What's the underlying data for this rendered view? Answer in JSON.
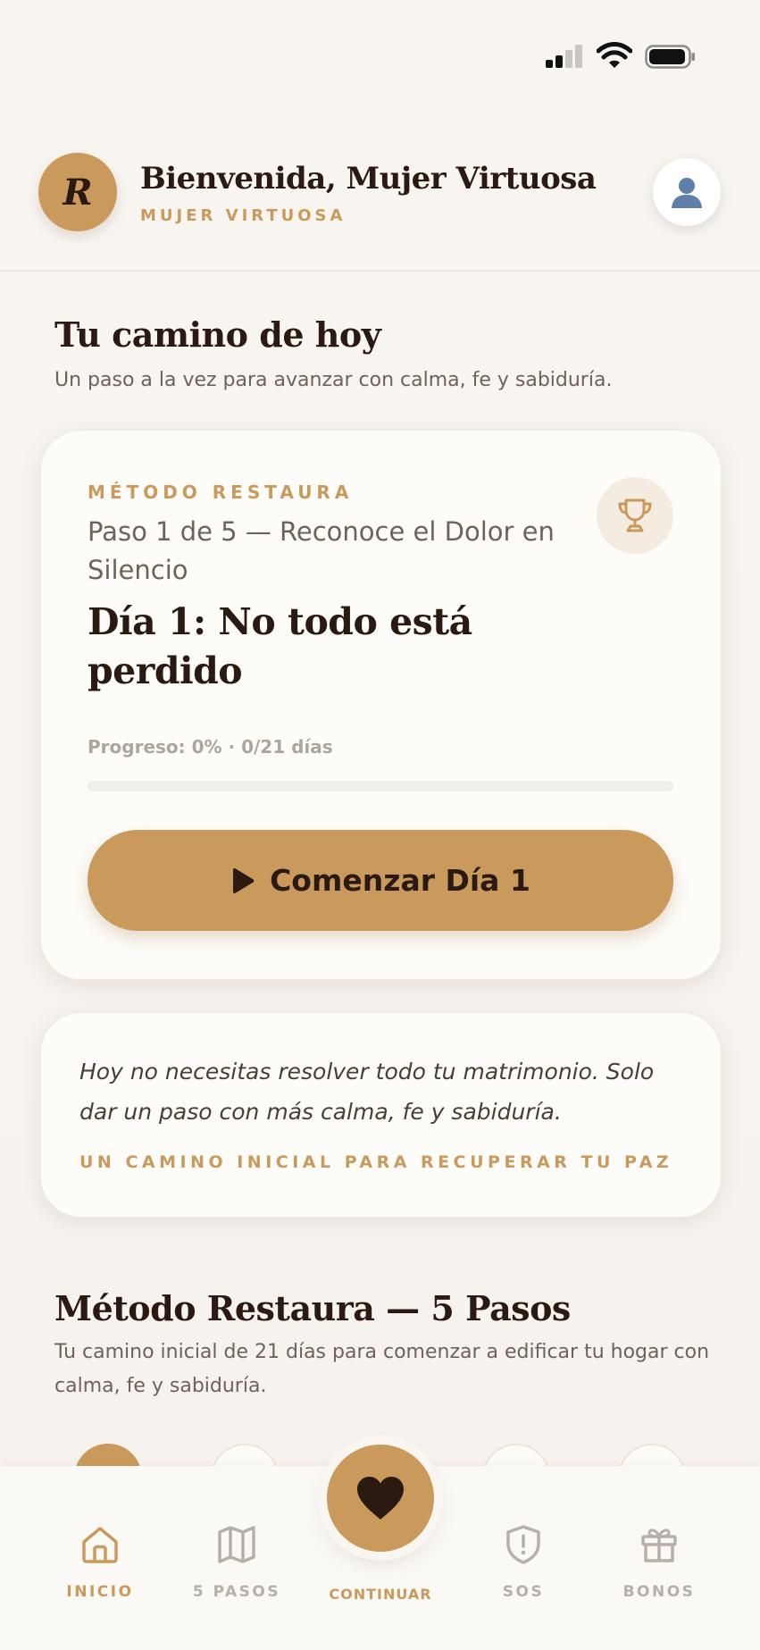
{
  "status_bar": {
    "signal_icon": "signal-icon",
    "wifi_icon": "wifi-icon",
    "battery_icon": "battery-icon"
  },
  "header": {
    "avatar_letter": "R",
    "title": "Bienvenida, Mujer Virtuosa",
    "subtitle": "MUJER VIRTUOSA",
    "profile_icon": "user-icon"
  },
  "today": {
    "title": "Tu camino de hoy",
    "subtitle": "Un paso a la vez para avanzar con calma, fe y sabiduría."
  },
  "main_card": {
    "method_label": "MÉTODO RESTAURA",
    "step_label": "Paso 1 de 5 — Reconoce el Dolor en Silencio",
    "day_title": "Día 1: No todo está perdido",
    "trophy_icon": "trophy-icon",
    "progress_text": "Progreso: 0% · 0/21 días",
    "progress_percent": 0,
    "start_button_label": "Comenzar Día 1",
    "play_icon": "play-icon"
  },
  "quote_card": {
    "text": "Hoy no necesitas resolver todo tu matrimonio. Solo dar un paso con más calma, fe y sabiduría.",
    "caption": "UN CAMINO INICIAL PARA RECUPERAR TU PAZ"
  },
  "method_section": {
    "title": "Método Restaura — 5 Pasos",
    "subtitle": "Tu camino inicial de 21 días para comenzar a edificar tu hogar con calma, fe y sabiduría."
  },
  "bottom_nav": {
    "items": [
      {
        "label": "INICIO",
        "icon": "home-icon",
        "active": true
      },
      {
        "label": "5 PASOS",
        "icon": "map-icon",
        "active": false
      },
      {
        "label": "CONTINUAR",
        "icon": "heart-icon",
        "active": false
      },
      {
        "label": "SOS",
        "icon": "shield-alert-icon",
        "active": false
      },
      {
        "label": "BONOS",
        "icon": "gift-icon",
        "active": false
      }
    ]
  },
  "colors": {
    "accent": "#c99a5b",
    "text_dark": "#2b1a12",
    "text_muted": "#6e625a",
    "inactive": "#b7afa8",
    "background": "#f7f3ee",
    "card": "#fefcf9"
  }
}
